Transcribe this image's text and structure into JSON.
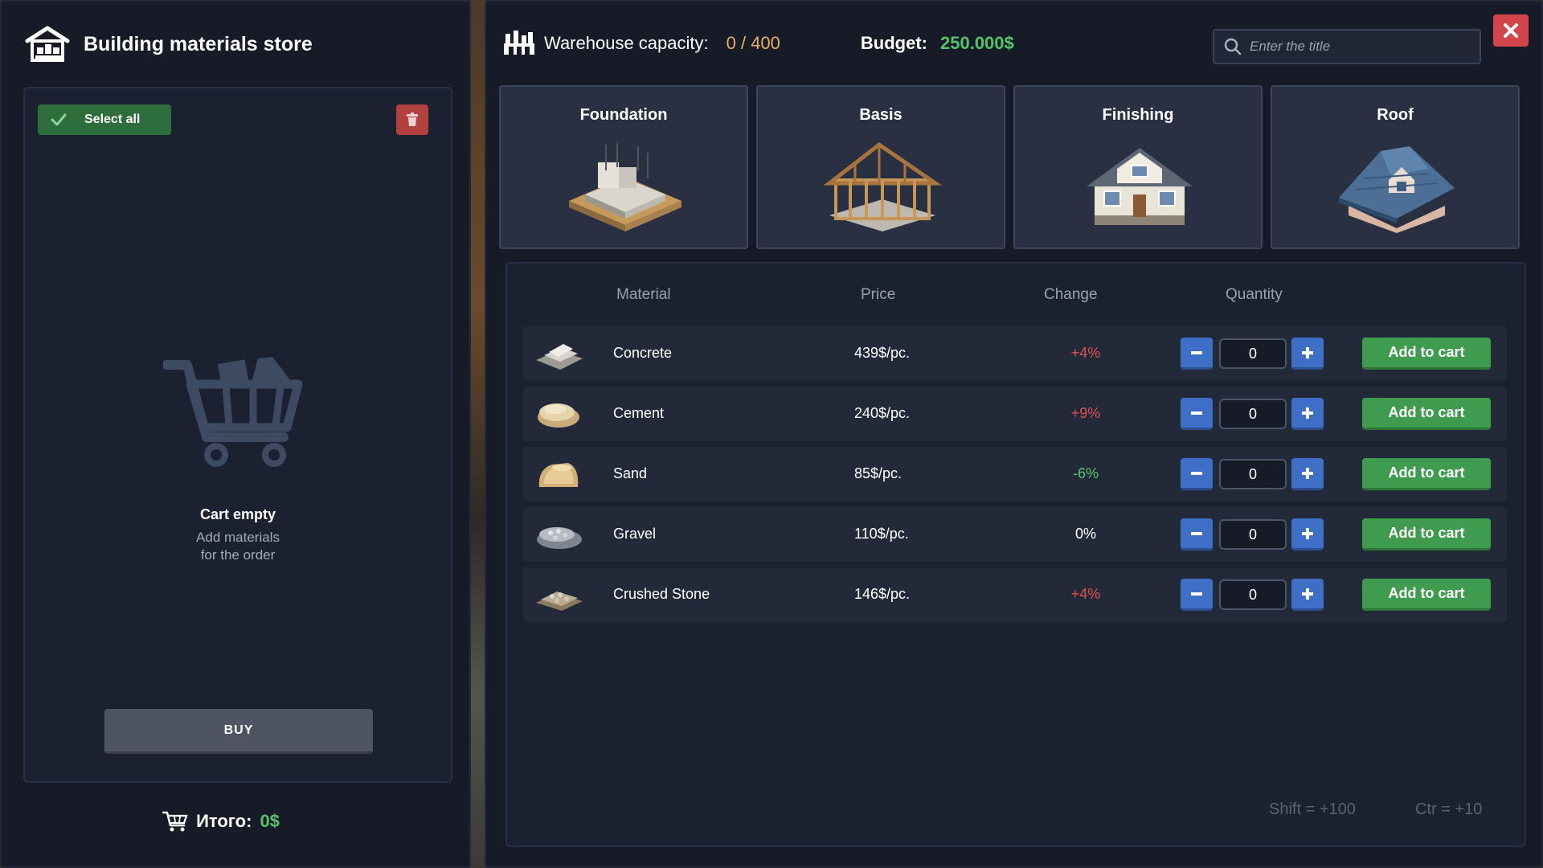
{
  "left": {
    "title": "Building materials store",
    "select_all_label": "Select all",
    "empty_title": "Cart empty",
    "empty_sub_line1": "Add materials",
    "empty_sub_line2": "for the order",
    "buy_label": "BUY",
    "total_label": "Итого:",
    "total_value": "0$"
  },
  "header": {
    "warehouse_label": "Warehouse capacity:",
    "warehouse_value": "0 / 400",
    "budget_label": "Budget:",
    "budget_value": "250.000$",
    "search_placeholder": "Enter the title",
    "search_value": ""
  },
  "categories": [
    {
      "label": "Foundation",
      "icon": "foundation-icon"
    },
    {
      "label": "Basis",
      "icon": "house-frame-icon"
    },
    {
      "label": "Finishing",
      "icon": "finished-house-icon"
    },
    {
      "label": "Roof",
      "icon": "roof-icon"
    }
  ],
  "table": {
    "columns": [
      "Material",
      "Price",
      "Change",
      "Quantity"
    ],
    "add_label": "Add to cart",
    "rows": [
      {
        "name": "Concrete",
        "price": "439$/pc.",
        "change": "+4%",
        "trend": "up",
        "qty": "0",
        "icon": "concrete-bag-icon"
      },
      {
        "name": "Cement",
        "price": "240$/pc.",
        "change": "+9%",
        "trend": "up",
        "qty": "0",
        "icon": "cement-sack-icon"
      },
      {
        "name": "Sand",
        "price": "85$/pc.",
        "change": "-6%",
        "trend": "down",
        "qty": "0",
        "icon": "sand-sack-icon"
      },
      {
        "name": "Gravel",
        "price": "110$/pc.",
        "change": "0%",
        "trend": "flat",
        "qty": "0",
        "icon": "gravel-bag-icon"
      },
      {
        "name": "Crushed Stone",
        "price": "146$/pc.",
        "change": "+4%",
        "trend": "up",
        "qty": "0",
        "icon": "crushed-stone-icon"
      }
    ]
  },
  "hints": {
    "shift": "Shift = +100",
    "ctrl": "Ctr = +10"
  },
  "colors": {
    "up": "#e0514f",
    "down": "#54c46a",
    "flat": "#ffffff",
    "accent_green": "#3f9c4e",
    "accent_blue": "#3e6fc7"
  }
}
